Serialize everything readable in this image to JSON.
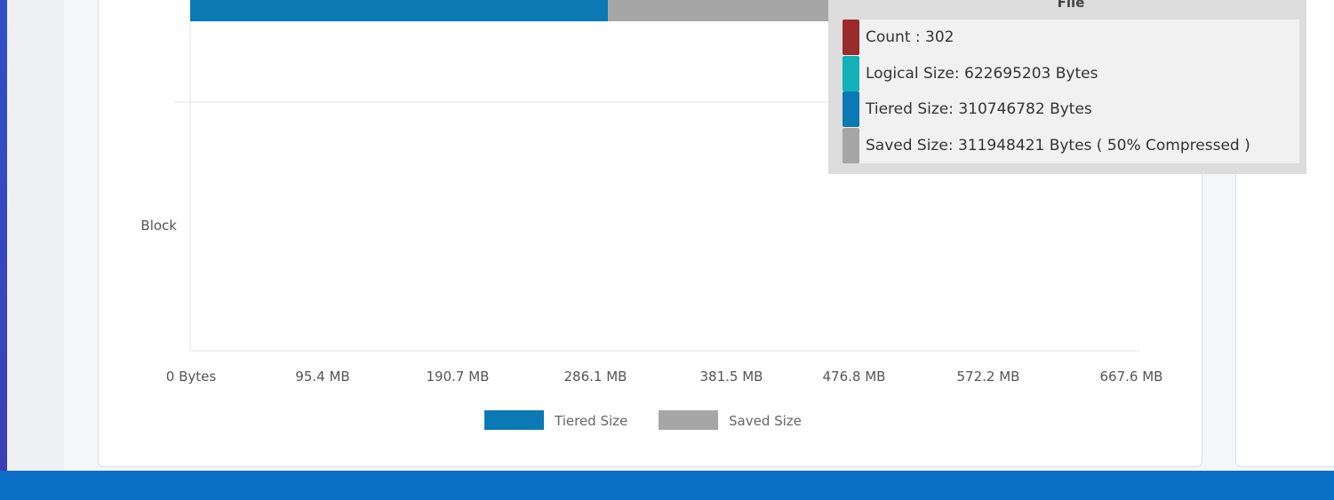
{
  "chart_data": {
    "type": "bar",
    "orientation": "horizontal",
    "stacked": true,
    "categories": [
      "File",
      "Block"
    ],
    "series": [
      {
        "name": "Tiered Size",
        "color": "#0a79b4",
        "values": [
          310746782,
          0
        ]
      },
      {
        "name": "Saved Size",
        "color": "#a6a6a6",
        "values": [
          311948421,
          0
        ]
      }
    ],
    "x_tick_labels": [
      "0 Bytes",
      "95.4 MB",
      "190.7 MB",
      "286.1 MB",
      "381.5 MB",
      "476.8 MB",
      "572.2 MB",
      "667.6 MB"
    ],
    "x_unit": "Bytes",
    "xlim": [
      0,
      700000000
    ],
    "grid": true,
    "legend_position": "bottom"
  },
  "tooltip": {
    "title": "File",
    "rows": [
      {
        "color": "#9b2a2a",
        "text": "Count : 302"
      },
      {
        "color": "#12b2b8",
        "text": "Logical Size: 622695203 Bytes"
      },
      {
        "color": "#0a79b4",
        "text": "Tiered Size: 310746782 Bytes"
      },
      {
        "color": "#a6a6a6",
        "text": "Saved Size: 311948421 Bytes ( 50% Compressed )"
      }
    ]
  }
}
